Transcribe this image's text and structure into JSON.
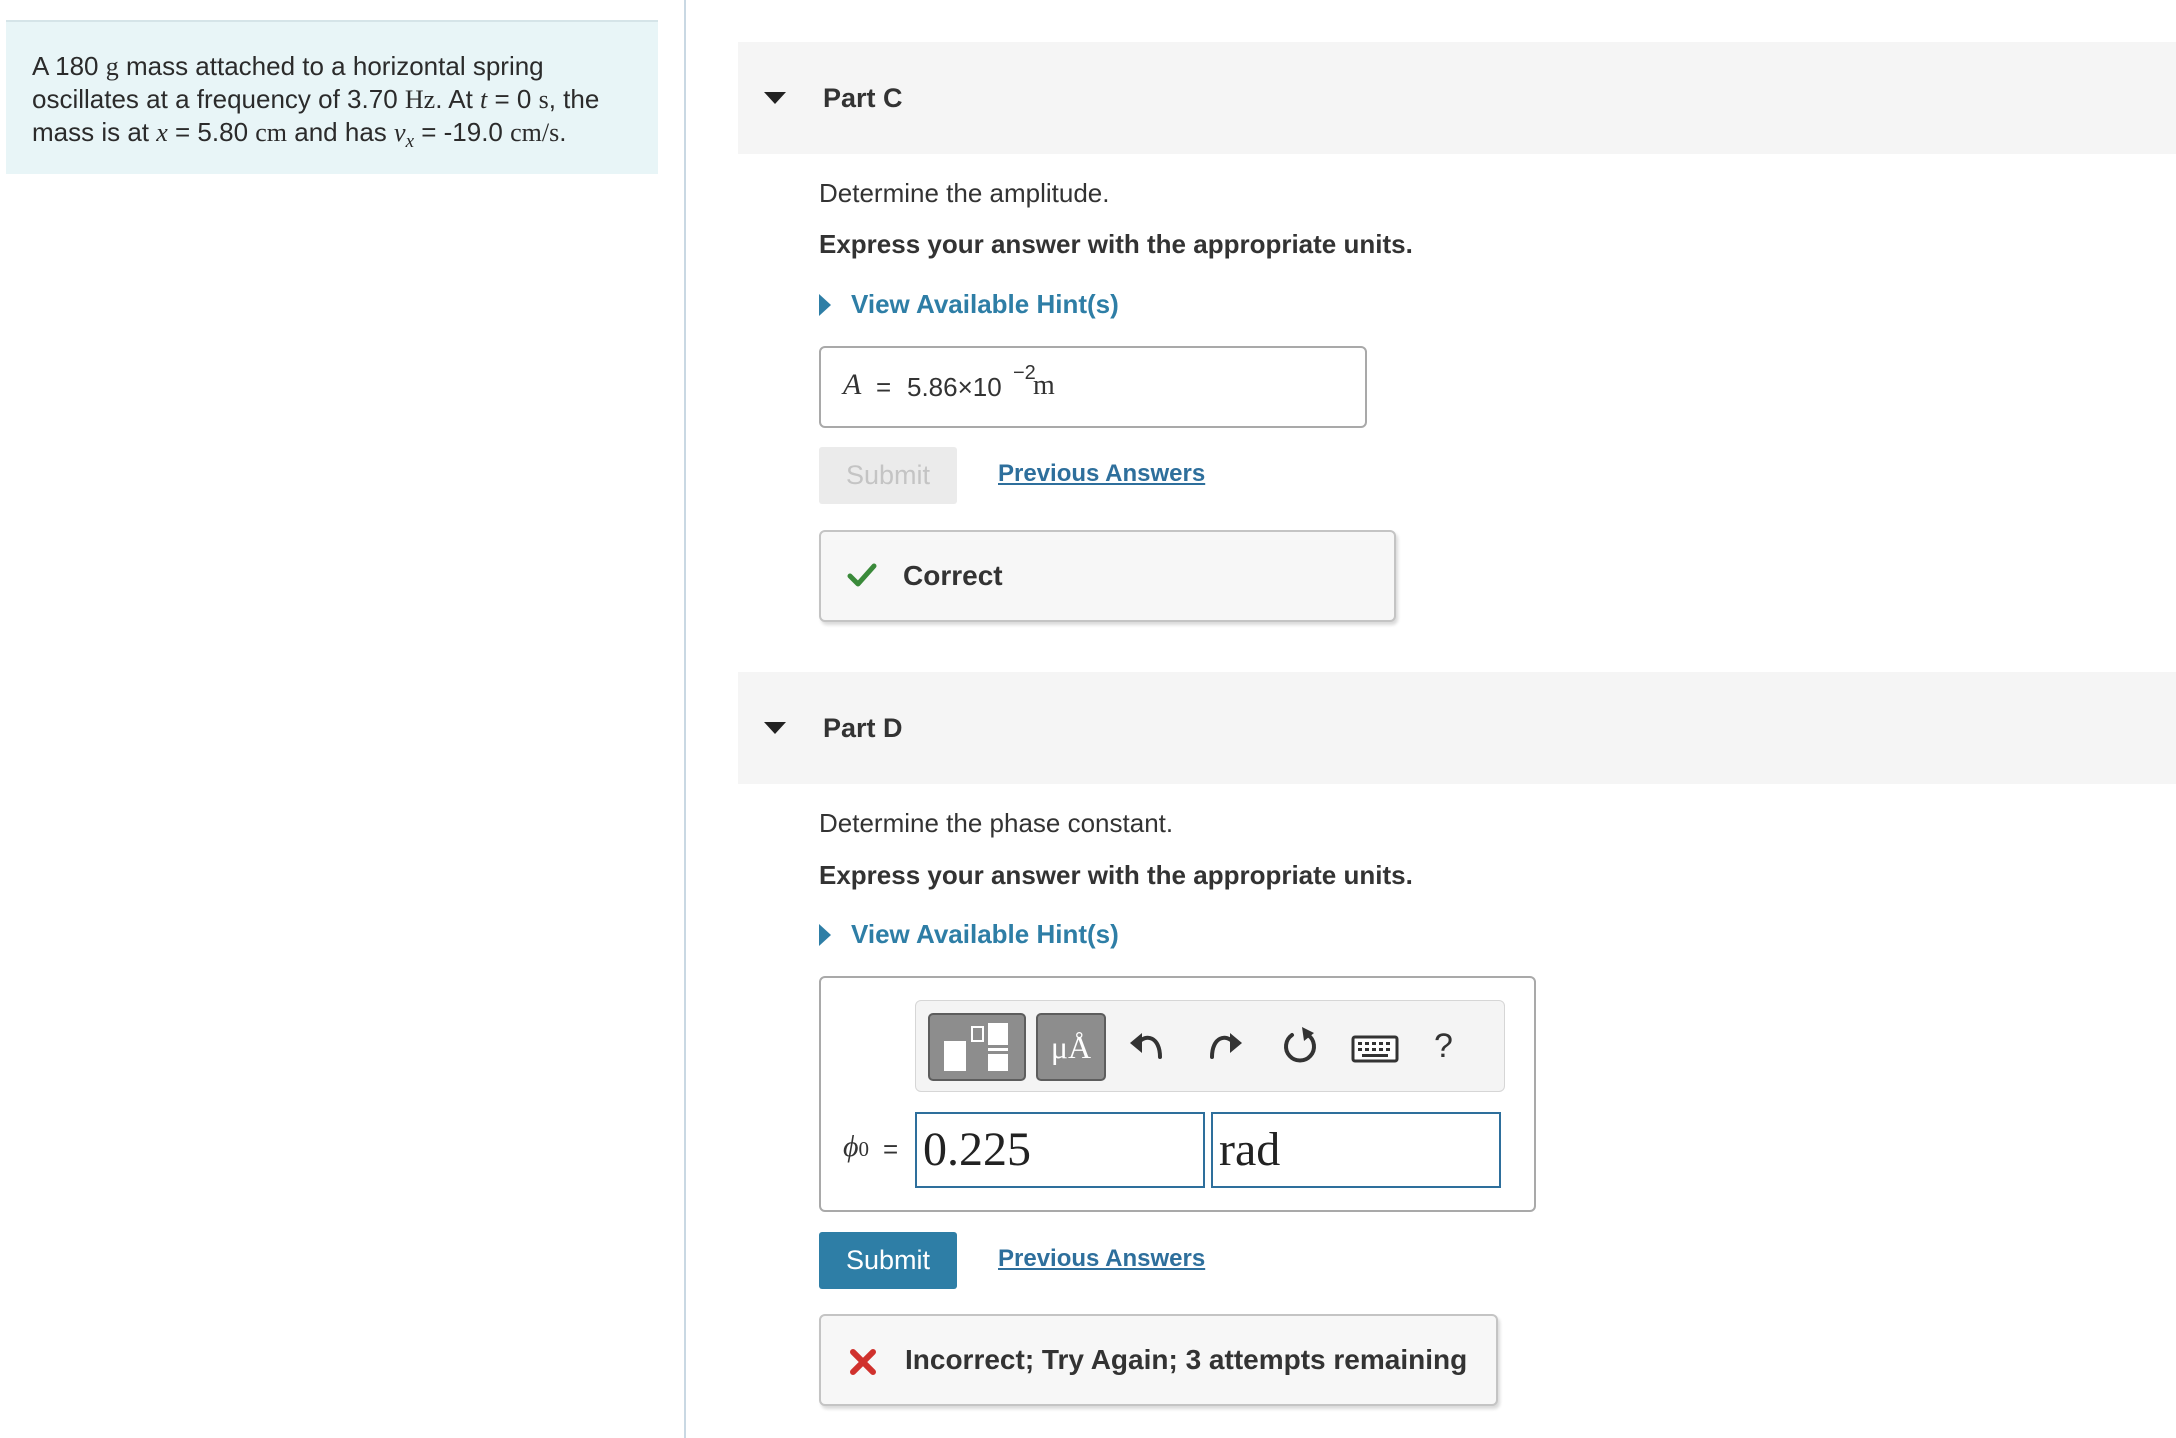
{
  "problem": {
    "text_1": "A 180 ",
    "mass_unit": "g",
    "text_2": " mass attached to a horizontal spring oscillates at a frequency of 3.70 ",
    "freq_unit": "Hz",
    "text_3": ". At ",
    "t_var": "t",
    "text_4": " = 0 ",
    "time_unit": "s",
    "text_5": ", the mass is at ",
    "x_var": "x",
    "text_6": " = 5.80 ",
    "pos_unit": "cm",
    "text_7": " and has ",
    "v_var": "v",
    "v_sub": "x",
    "text_8": " = -19.0 ",
    "vel_unit": "cm/s",
    "text_9": "."
  },
  "part_c": {
    "title": "Part C",
    "prompt": "Determine the amplitude.",
    "instruction": "Express your answer with the appropriate units.",
    "hint_label": "View Available Hint(s)",
    "answer_label": "A",
    "answer_equals": "=",
    "answer_mantissa": "5.86×10",
    "answer_exponent": "−2",
    "answer_unit": "m",
    "submit_label": "Submit",
    "previous_answers_label": "Previous Answers",
    "feedback": "Correct",
    "feedback_color": "#3a8a3a"
  },
  "part_d": {
    "title": "Part D",
    "prompt": "Determine the phase constant.",
    "instruction": "Express your answer with the appropriate units.",
    "hint_label": "View Available Hint(s)",
    "answer_label": "ϕ",
    "answer_label_sub": "0",
    "answer_equals": "=",
    "value": "0.225",
    "unit": "rad",
    "toolbar": {
      "units_button": "μÅ",
      "help_button": "?",
      "icons": [
        "templates-icon",
        "units-icon",
        "undo-icon",
        "redo-icon",
        "reset-icon",
        "keyboard-icon",
        "help-icon"
      ]
    },
    "submit_label": "Submit",
    "previous_answers_label": "Previous Answers",
    "feedback": "Incorrect; Try Again; 3 attempts remaining",
    "feedback_color": "#d0312d"
  },
  "colors": {
    "accent": "#2e7ea6",
    "problem_bg": "#e8f5f7",
    "header_bg": "#f5f5f5"
  }
}
